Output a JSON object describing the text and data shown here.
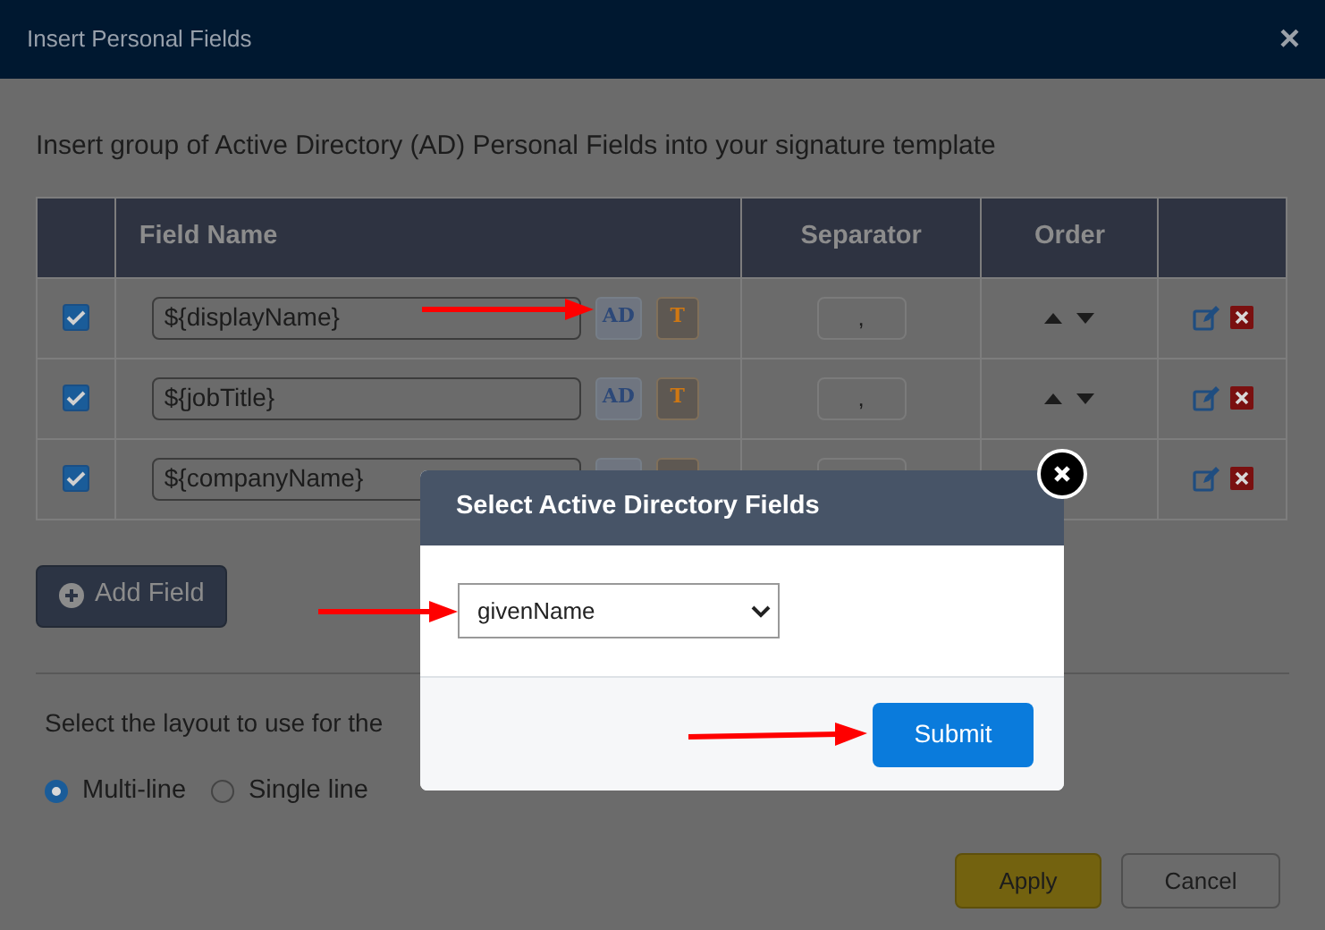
{
  "window": {
    "title": "Insert Personal Fields",
    "close": "×"
  },
  "intro": "Insert group of Active Directory (AD) Personal Fields into your signature template",
  "table": {
    "columns": [
      "Field Name",
      "Separator",
      "Order"
    ],
    "rows": [
      {
        "checked": true,
        "field": "${displayName}",
        "ad": "AD",
        "t": "T",
        "separator": ",",
        "order_arrows": true
      },
      {
        "checked": true,
        "field": "${jobTitle}",
        "ad": "AD",
        "t": "T",
        "separator": ",",
        "order_arrows": true
      },
      {
        "checked": true,
        "field": "${companyName}",
        "order_arrows": false
      }
    ]
  },
  "add_button": "Add Field",
  "layout_prompt": "Select the layout to use for the",
  "layout_options": [
    {
      "label": "Multi-line",
      "selected": true
    },
    {
      "label": "Single line",
      "selected": false
    }
  ],
  "buttons": {
    "apply": "Apply",
    "cancel": "Cancel"
  },
  "dialog": {
    "title": "Select Active Directory Fields",
    "select_value": "givenName",
    "submit": "Submit"
  }
}
